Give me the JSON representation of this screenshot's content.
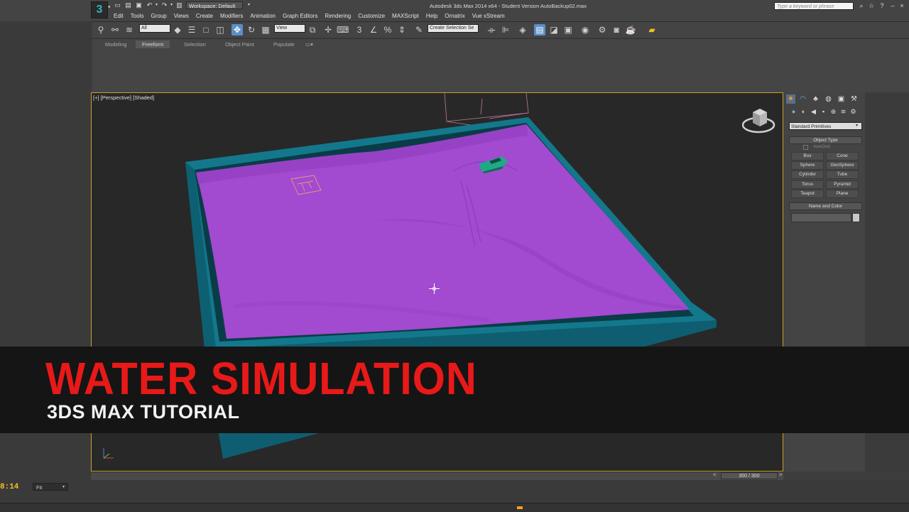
{
  "window": {
    "title": "Autodesk 3ds Max  2014 x64  - Student Version   AutoBackup02.max",
    "workspace": "Workspace: Default",
    "search_placeholder": "Type a keyword or phrase",
    "logo": "3"
  },
  "menu": [
    "Edit",
    "Tools",
    "Group",
    "Views",
    "Create",
    "Modifiers",
    "Animation",
    "Graph Editors",
    "Rendering",
    "Customize",
    "MAXScript",
    "Help",
    "Ornatrix",
    "Vue xStream"
  ],
  "toolbar": {
    "filter": "All",
    "ref_coord": "View",
    "selection_set": "Create Selection Se"
  },
  "ribbon": {
    "tabs": [
      "Modeling",
      "Freeform",
      "Selection",
      "Object Paint",
      "Populate"
    ],
    "active": "Freeform"
  },
  "viewport": {
    "label": "[+] [Perspective] [Shaded]",
    "colors": {
      "water": "#a24ad0",
      "walls": "#0f6577",
      "boat": "#1faa86"
    }
  },
  "command_panel": {
    "dropdown": "Standard Primitives",
    "object_type_header": "Object Type",
    "autogrid": "AutoGrid",
    "buttons": [
      "Box",
      "Cone",
      "Sphere",
      "GeoSphere",
      "Cylinder",
      "Tube",
      "Torus",
      "Pyramid",
      "Teapot",
      "Plane"
    ],
    "name_color_header": "Name and Color"
  },
  "timeline": {
    "frame": "300 / 300"
  },
  "status": {
    "timecode": "8:14",
    "zoom": "Fit"
  },
  "banner": {
    "title": "WATER SIMULATION",
    "subtitle": "3DS MAX TUTORIAL",
    "title_color": "#e81919"
  }
}
